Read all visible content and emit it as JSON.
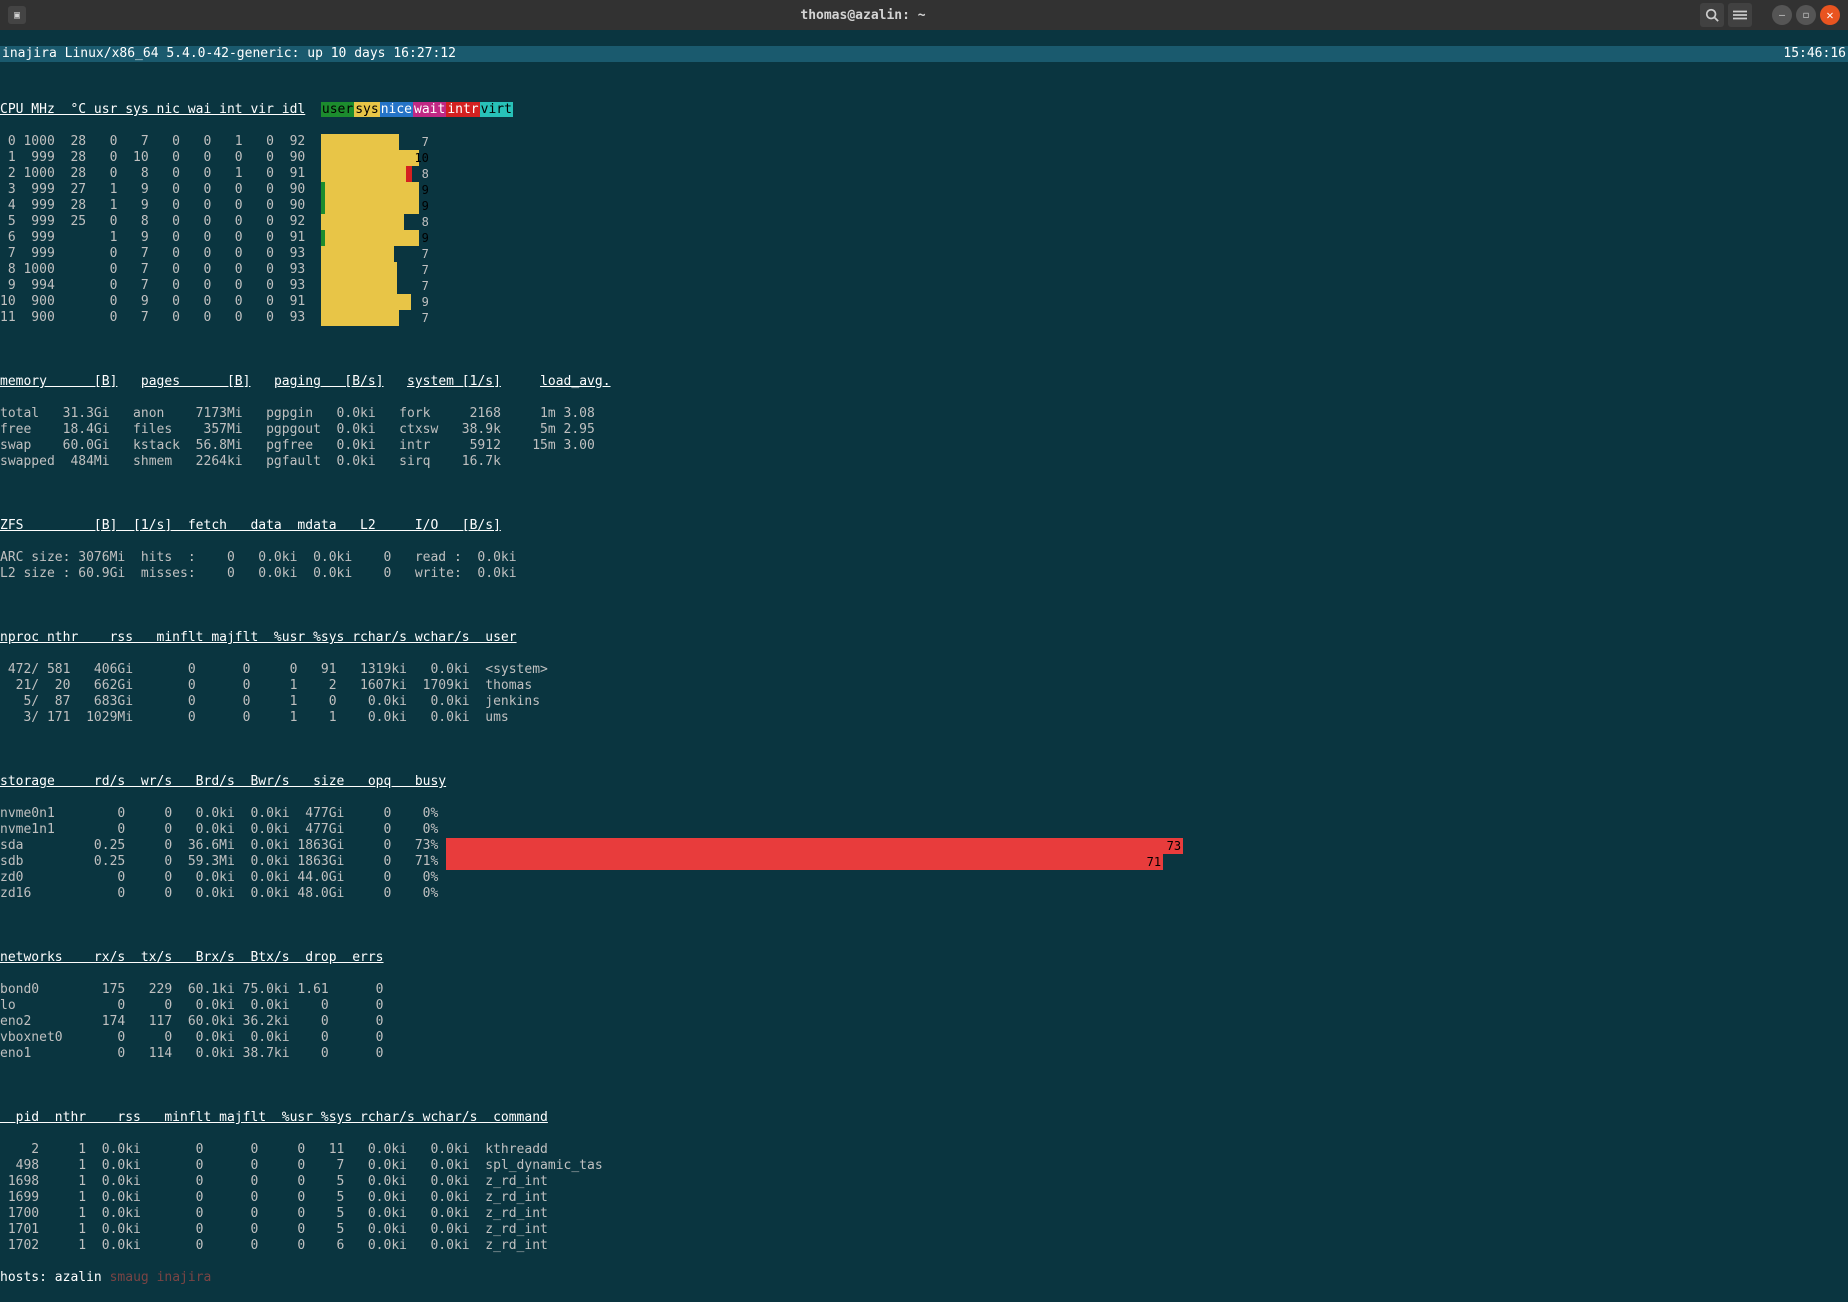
{
  "window": {
    "title": "thomas@azalin: ~"
  },
  "header": {
    "text": "inajira Linux/x86_64 5.4.0-42-generic: up 10 days 16:27:12",
    "clock": "15:46:16"
  },
  "cpu_legend": [
    "user",
    "sys",
    "nice",
    "wait",
    "intr",
    "virt"
  ],
  "cpu_header": "CPU MHz  °C usr sys nic wai int vir idl",
  "cpu_rows": [
    {
      "id": "0",
      "mhz": "1000",
      "tc": "28",
      "usr": "0",
      "sys": "7",
      "nic": "0",
      "wai": "0",
      "int": "1",
      "vir": "0",
      "idl": "92",
      "bar_user": 0,
      "bar_sys": 78,
      "label": "7"
    },
    {
      "id": "1",
      "mhz": "999",
      "tc": "28",
      "usr": "0",
      "sys": "10",
      "nic": "0",
      "wai": "0",
      "int": "0",
      "vir": "0",
      "idl": "90",
      "bar_user": 0,
      "bar_sys": 98,
      "label": "10"
    },
    {
      "id": "2",
      "mhz": "1000",
      "tc": "28",
      "usr": "0",
      "sys": "8",
      "nic": "0",
      "wai": "0",
      "int": "1",
      "vir": "0",
      "idl": "91",
      "bar_user": 0,
      "bar_sys": 85,
      "label": "8",
      "intr": 1
    },
    {
      "id": "3",
      "mhz": "999",
      "tc": "27",
      "usr": "1",
      "sys": "9",
      "nic": "0",
      "wai": "0",
      "int": "0",
      "vir": "0",
      "idl": "90",
      "bar_user": 4,
      "bar_sys": 94,
      "label": "9"
    },
    {
      "id": "4",
      "mhz": "999",
      "tc": "28",
      "usr": "1",
      "sys": "9",
      "nic": "0",
      "wai": "0",
      "int": "0",
      "vir": "0",
      "idl": "90",
      "bar_user": 4,
      "bar_sys": 94,
      "label": "9"
    },
    {
      "id": "5",
      "mhz": "999",
      "tc": "25",
      "usr": "0",
      "sys": "8",
      "nic": "0",
      "wai": "0",
      "int": "0",
      "vir": "0",
      "idl": "92",
      "bar_user": 0,
      "bar_sys": 83,
      "label": "8"
    },
    {
      "id": "6",
      "mhz": "999",
      "tc": "",
      "usr": "1",
      "sys": "9",
      "nic": "0",
      "wai": "0",
      "int": "0",
      "vir": "0",
      "idl": "91",
      "bar_user": 4,
      "bar_sys": 94,
      "label": "9"
    },
    {
      "id": "7",
      "mhz": "999",
      "tc": "",
      "usr": "0",
      "sys": "7",
      "nic": "0",
      "wai": "0",
      "int": "0",
      "vir": "0",
      "idl": "93",
      "bar_user": 0,
      "bar_sys": 73,
      "label": "7"
    },
    {
      "id": "8",
      "mhz": "1000",
      "tc": "",
      "usr": "0",
      "sys": "7",
      "nic": "0",
      "wai": "0",
      "int": "0",
      "vir": "0",
      "idl": "93",
      "bar_user": 0,
      "bar_sys": 76,
      "label": "7"
    },
    {
      "id": "9",
      "mhz": "994",
      "tc": "",
      "usr": "0",
      "sys": "7",
      "nic": "0",
      "wai": "0",
      "int": "0",
      "vir": "0",
      "idl": "93",
      "bar_user": 0,
      "bar_sys": 76,
      "label": "7"
    },
    {
      "id": "10",
      "mhz": "900",
      "tc": "",
      "usr": "0",
      "sys": "9",
      "nic": "0",
      "wai": "0",
      "int": "0",
      "vir": "0",
      "idl": "91",
      "bar_user": 0,
      "bar_sys": 90,
      "label": "9"
    },
    {
      "id": "11",
      "mhz": "900",
      "tc": "",
      "usr": "0",
      "sys": "7",
      "nic": "0",
      "wai": "0",
      "int": "0",
      "vir": "0",
      "idl": "93",
      "bar_user": 0,
      "bar_sys": 78,
      "label": "7"
    }
  ],
  "memory": {
    "hdr_mem": "memory      [B]",
    "hdr_pages": "pages      [B]",
    "hdr_paging": "paging   [B/s]",
    "hdr_system": "system [1/s]",
    "hdr_load": "load_avg.",
    "rows": [
      [
        "total",
        "31.3Gi",
        "anon",
        "7173Mi",
        "pgpgin",
        "0.0ki",
        "fork",
        "2168",
        "1m 3.08"
      ],
      [
        "free",
        "18.4Gi",
        "files",
        "357Mi",
        "pgpgout",
        "0.0ki",
        "ctxsw",
        "38.9k",
        "5m 2.95"
      ],
      [
        "swap",
        "60.0Gi",
        "kstack",
        "56.8Mi",
        "pgfree",
        "0.0ki",
        "intr",
        "5912",
        "15m 3.00"
      ],
      [
        "swapped",
        "484Mi",
        "shmem",
        "2264ki",
        "pgfault",
        "0.0ki",
        "sirq",
        "16.7k",
        ""
      ]
    ]
  },
  "zfs": {
    "hdr": "ZFS         [B]  [1/s]  fetch   data  mdata   L2     I/O   [B/s]",
    "rows": [
      "ARC size: 3076Mi  hits  :    0   0.0ki  0.0ki    0   read :  0.0ki",
      "L2 size : 60.9Gi  misses:    0   0.0ki  0.0ki    0   write:  0.0ki"
    ]
  },
  "nproc": {
    "hdr": "nproc nthr    rss   minflt majflt  %usr %sys rchar/s wchar/s  user",
    "rows": [
      " 472/ 581   406Gi       0      0     0   91   1319ki   0.0ki  <system>",
      "  21/  20   662Gi       0      0     1    2   1607ki  1709ki  thomas",
      "   5/  87   683Gi       0      0     1    0    0.0ki   0.0ki  jenkins",
      "   3/ 171  1029Mi       0      0     1    1    0.0ki   0.0ki  ums"
    ]
  },
  "storage": {
    "hdr": "storage     rd/s  wr/s   Brd/s  Bwr/s   size   opq   busy",
    "rows": [
      {
        "line": "nvme0n1        0     0   0.0ki  0.0ki  477Gi     0    0%",
        "busy": 0
      },
      {
        "line": "nvme1n1        0     0   0.0ki  0.0ki  477Gi     0    0%",
        "busy": 0
      },
      {
        "line": "sda         0.25     0  36.6Mi  0.0ki 1863Gi     0   73%",
        "busy": 73
      },
      {
        "line": "sdb         0.25     0  59.3Mi  0.0ki 1863Gi     0   71%",
        "busy": 71
      },
      {
        "line": "zd0            0     0   0.0ki  0.0ki 44.0Gi     0    0%",
        "busy": 0
      },
      {
        "line": "zd16           0     0   0.0ki  0.0ki 48.0Gi     0    0%",
        "busy": 0
      }
    ]
  },
  "networks": {
    "hdr": "networks    rx/s  tx/s   Brx/s  Btx/s  drop  errs",
    "rows": [
      "bond0        175   229  60.1ki 75.0ki 1.61      0",
      "lo             0     0   0.0ki  0.0ki    0      0",
      "eno2         174   117  60.0ki 36.2ki    0      0",
      "vboxnet0       0     0   0.0ki  0.0ki    0      0",
      "eno1           0   114   0.0ki 38.7ki    0      0"
    ]
  },
  "pid": {
    "hdr": "  pid  nthr    rss   minflt majflt  %usr %sys rchar/s wchar/s  command",
    "rows": [
      "    2     1  0.0ki       0      0     0   11   0.0ki   0.0ki  kthreadd",
      "  498     1  0.0ki       0      0     0    7   0.0ki   0.0ki  spl_dynamic_tas",
      " 1698     1  0.0ki       0      0     0    5   0.0ki   0.0ki  z_rd_int",
      " 1699     1  0.0ki       0      0     0    5   0.0ki   0.0ki  z_rd_int",
      " 1700     1  0.0ki       0      0     0    5   0.0ki   0.0ki  z_rd_int",
      " 1701     1  0.0ki       0      0     0    5   0.0ki   0.0ki  z_rd_int",
      " 1702     1  0.0ki       0      0     0    6   0.0ki   0.0ki  z_rd_int"
    ]
  },
  "hosts": {
    "label": "hosts:",
    "active": "azalin",
    "dim1": "smaug",
    "dim2": "inajira"
  }
}
